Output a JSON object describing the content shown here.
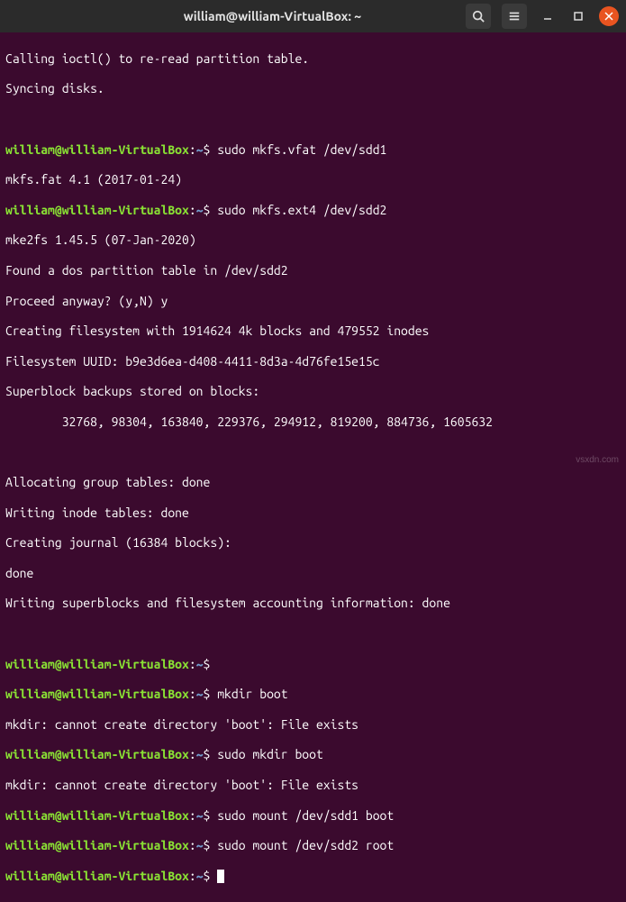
{
  "window": {
    "title": "william@william-VirtualBox: ~"
  },
  "prompt": {
    "userhost": "william@william-VirtualBox",
    "separator": ":",
    "path": "~",
    "symbol": "$"
  },
  "lines": {
    "l1": "Calling ioctl() to re-read partition table.",
    "l2": "Syncing disks.",
    "l3": "",
    "cmd1": " sudo mkfs.vfat /dev/sdd1",
    "l4": "mkfs.fat 4.1 (2017-01-24)",
    "cmd2": " sudo mkfs.ext4 /dev/sdd2",
    "l5": "mke2fs 1.45.5 (07-Jan-2020)",
    "l6": "Found a dos partition table in /dev/sdd2",
    "l7": "Proceed anyway? (y,N) y",
    "l8": "Creating filesystem with 1914624 4k blocks and 479552 inodes",
    "l9": "Filesystem UUID: b9e3d6ea-d408-4411-8d3a-4d76fe15e15c",
    "l10": "Superblock backups stored on blocks:",
    "l11": "        32768, 98304, 163840, 229376, 294912, 819200, 884736, 1605632",
    "l12": "",
    "l13": "Allocating group tables: done",
    "l14": "Writing inode tables: done",
    "l15": "Creating journal (16384 blocks):",
    "l16": "done",
    "l17": "Writing superblocks and filesystem accounting information: done",
    "l18": "",
    "cmd3": "",
    "cmd4": " mkdir boot",
    "l19": "mkdir: cannot create directory 'boot': File exists",
    "cmd5": " sudo mkdir boot",
    "l20": "mkdir: cannot create directory 'boot': File exists",
    "cmd6": " sudo mount /dev/sdd1 boot",
    "cmd7": " sudo mount /dev/sdd2 root",
    "cmd8": " "
  },
  "watermark": "vsxdn.com"
}
